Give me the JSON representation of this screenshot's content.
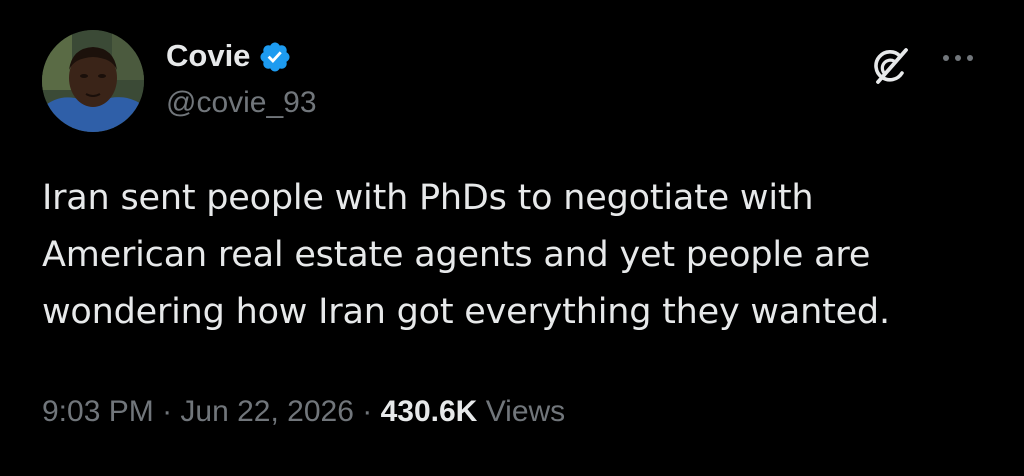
{
  "author": {
    "display_name": "Covie",
    "handle": "@covie_93",
    "verified": true,
    "verified_color": "#1d9bf0"
  },
  "tweet": {
    "text": "Iran sent people with PhDs to negotiate with\nAmerican real estate agents and yet people are\nwondering how Iran got everything they wanted."
  },
  "meta": {
    "time": "9:03 PM",
    "separator": "·",
    "date": "Jun 22, 2026",
    "views_count": "430.6K",
    "views_label": "Views"
  },
  "icons": {
    "grok": "grok-icon",
    "more": "more-icon",
    "verified": "verified-badge-icon"
  },
  "colors": {
    "background": "#000000",
    "primary_text": "#e7e9ea",
    "secondary_text": "#71767b"
  }
}
